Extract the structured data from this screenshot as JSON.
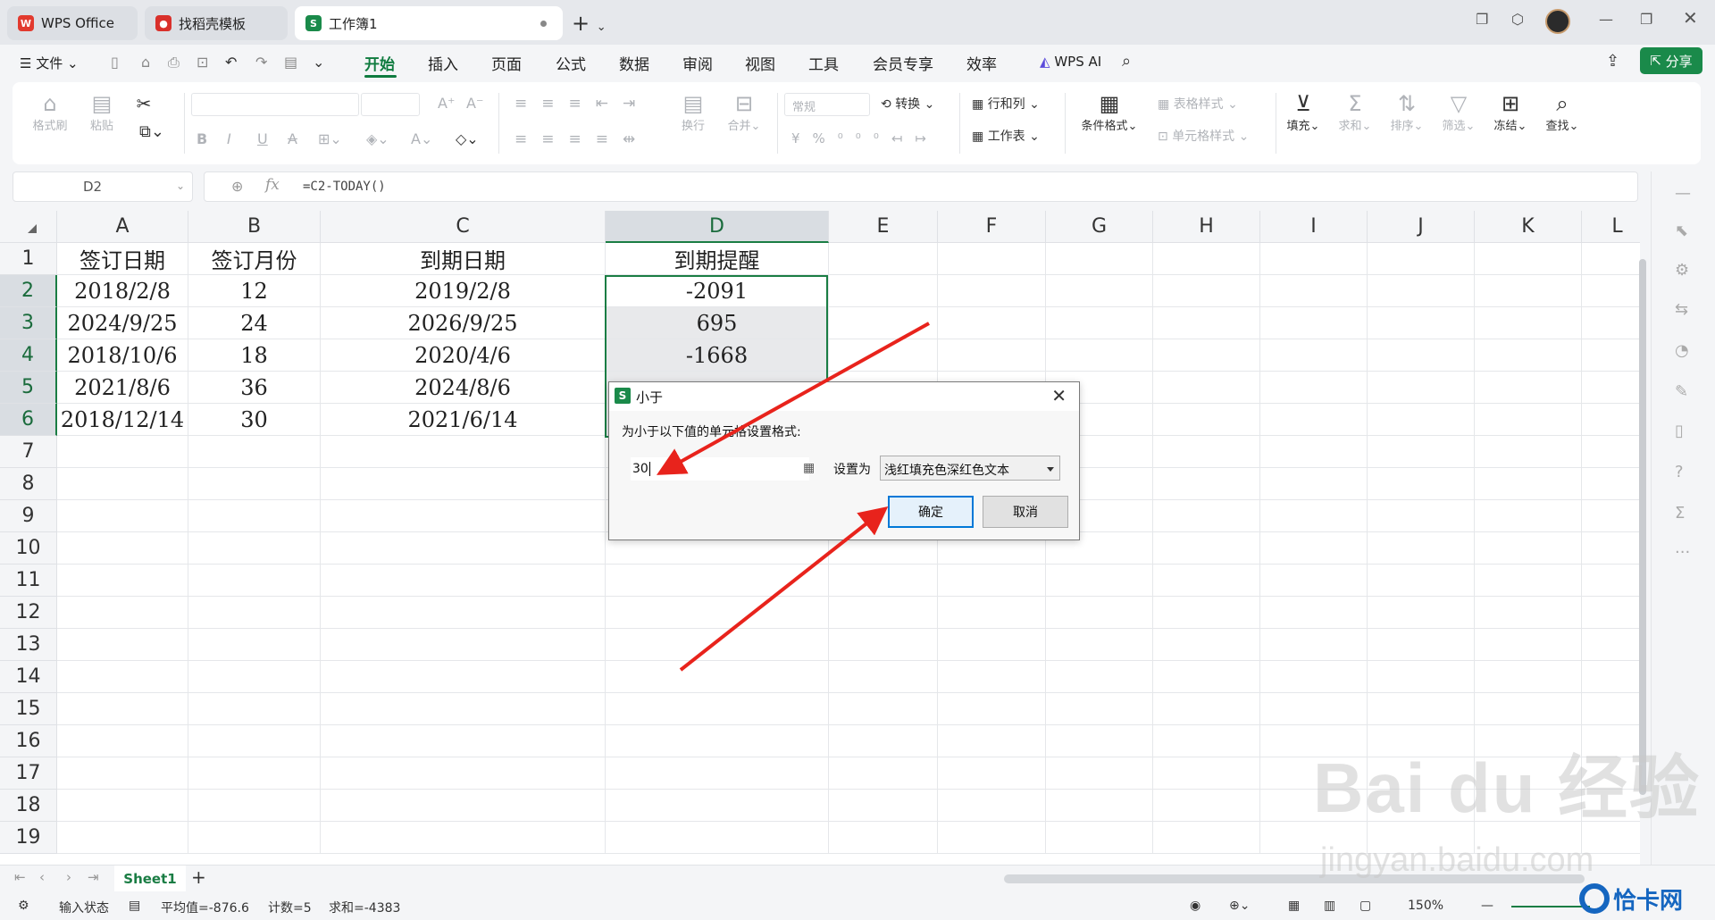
{
  "tabs": [
    {
      "label": "WPS Office",
      "color": "#e23a2e"
    },
    {
      "label": "找稻壳模板",
      "color": "#d9302b"
    },
    {
      "label": "工作簿1",
      "color": "#1a8a4a",
      "icon_text": "S"
    }
  ],
  "menu": {
    "file": "文件",
    "items": [
      "开始",
      "插入",
      "页面",
      "公式",
      "数据",
      "审阅",
      "视图",
      "工具",
      "会员专享",
      "效率"
    ],
    "active": "开始",
    "ai": "WPS AI",
    "share": "分享"
  },
  "ribbon": {
    "format_painter": "格式刷",
    "paste": "粘贴",
    "wrap": "换行",
    "merge": "合并",
    "number_format": "常规",
    "convert": "转换",
    "row_col": "行和列",
    "worksheet": "工作表",
    "cond_format": "条件格式",
    "table_style": "表格样式",
    "cell_style": "单元格样式",
    "fill": "填充",
    "sum": "求和",
    "sort": "排序",
    "filter": "筛选",
    "freeze": "冻结",
    "find": "查找"
  },
  "formula_bar": {
    "name_box": "D2",
    "fx": "fx",
    "formula": "=C2-TODAY()"
  },
  "columns": [
    "A",
    "B",
    "C",
    "D",
    "E",
    "F",
    "G",
    "H",
    "I",
    "J",
    "K",
    "L"
  ],
  "rows": [
    "1",
    "2",
    "3",
    "4",
    "5",
    "6",
    "7",
    "8",
    "9",
    "10",
    "11",
    "12",
    "13",
    "14",
    "15",
    "16",
    "17",
    "18",
    "19"
  ],
  "table": {
    "headers": [
      "签订日期",
      "签订月份",
      "到期日期",
      "到期提醒"
    ],
    "data": [
      [
        "2018/2/8",
        "12",
        "2019/2/8",
        "-2091"
      ],
      [
        "2024/9/25",
        "24",
        "2026/9/25",
        "695"
      ],
      [
        "2018/10/6",
        "18",
        "2020/4/6",
        "-1668"
      ],
      [
        "2021/8/6",
        "36",
        "2024/8/6",
        ""
      ],
      [
        "2018/12/14",
        "30",
        "2021/6/14",
        ""
      ]
    ]
  },
  "sheet": {
    "tab": "Sheet1",
    "add": "+"
  },
  "status": {
    "input_state": "输入状态",
    "average": "平均值=-876.6",
    "count": "计数=5",
    "sum": "求和=-4383",
    "zoom": "150%"
  },
  "dialog": {
    "title": "小于",
    "icon_text": "S",
    "prompt": "为小于以下值的单元格设置格式:",
    "value": "30",
    "set_as_label": "设置为",
    "format_option": "浅红填充色深红色文本",
    "ok": "确定",
    "cancel": "取消"
  },
  "watermark": {
    "brand": "Bai du 经验",
    "url": "jingyan.baidu.com",
    "badge": "恰卡网"
  },
  "colors": {
    "accent": "#1a7d44",
    "arrow": "#e8231c"
  }
}
